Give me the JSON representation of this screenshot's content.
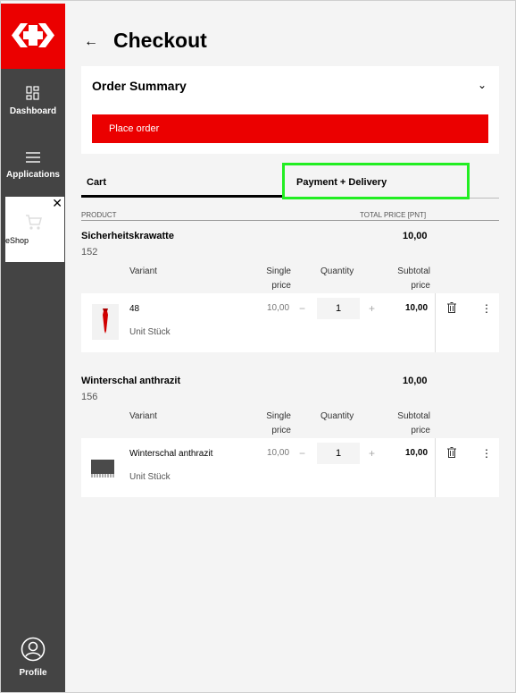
{
  "sidebar": {
    "items": [
      {
        "label": "Dashboard",
        "icon": "dashboard-icon"
      },
      {
        "label": "Applications",
        "icon": "menu-icon"
      }
    ],
    "open_app": {
      "label": "eShop",
      "icon": "cart-icon"
    },
    "profile": {
      "label": "Profile",
      "icon": "profile-icon"
    }
  },
  "page": {
    "title": "Checkout"
  },
  "summary": {
    "title": "Order Summary",
    "place_order": "Place order"
  },
  "tabs": [
    {
      "label": "Cart"
    },
    {
      "label": "Payment + Delivery"
    }
  ],
  "columns": {
    "product": "PRODUCT",
    "total": "TOTAL PRICE [PNT]"
  },
  "item_headers": {
    "variant": "Variant",
    "single_price": "Single price",
    "quantity": "Quantity",
    "subtotal": "Subtotal price"
  },
  "products": [
    {
      "name": "Sicherheitskrawatte",
      "number": "152",
      "total": "10,00",
      "variant": "48",
      "unit": "Unit Stück",
      "single_price": "10,00",
      "quantity": "1",
      "subtotal": "10,00",
      "image": "red-tie"
    },
    {
      "name": "Winterschal anthrazit",
      "number": "156",
      "total": "10,00",
      "variant": "Winterschal anthrazit",
      "unit": "Unit Stück",
      "single_price": "10,00",
      "quantity": "1",
      "subtotal": "10,00",
      "image": "grey-scarf"
    }
  ],
  "colors": {
    "brand_red": "#eb0000",
    "sidebar_bg": "#444444",
    "highlight": "#22ee22"
  }
}
